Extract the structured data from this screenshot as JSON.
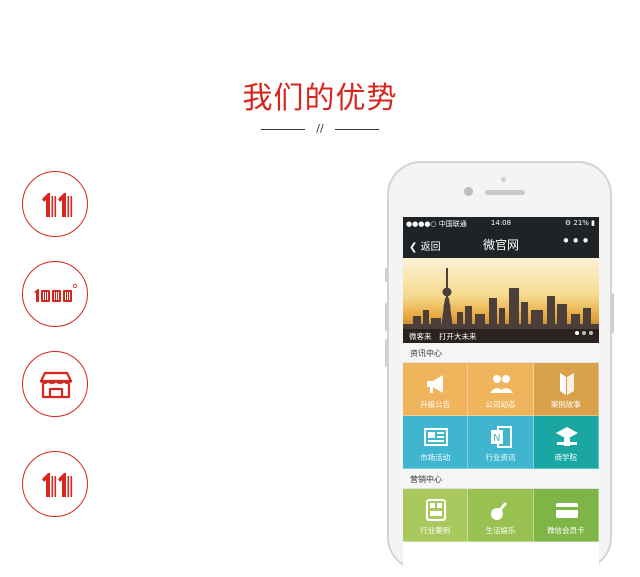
{
  "header": {
    "title": "我们的优势",
    "divider_mark": "//"
  },
  "features": [
    {
      "icon": "eleven-icon"
    },
    {
      "icon": "thousand-icon"
    },
    {
      "icon": "storefront-icon"
    },
    {
      "icon": "eleven-icon"
    }
  ],
  "phone": {
    "status": {
      "carrier": "●●●●○ 中国联通",
      "time": "14:08",
      "battery": "21%"
    },
    "nav": {
      "back": "返回",
      "title": "微官网",
      "more": "•••"
    },
    "banner": {
      "caption": "微客来　打开大未来",
      "dots": 3,
      "active_dot": 1
    },
    "sections": [
      {
        "title": "资讯中心",
        "tiles": [
          {
            "label": "升级公告",
            "icon": "megaphone-icon",
            "color": "#f0b45c"
          },
          {
            "label": "公司动态",
            "icon": "users-icon",
            "color": "#f0b45c"
          },
          {
            "label": "案例故事",
            "icon": "book-icon",
            "color": "#d9a24a"
          },
          {
            "label": "市场活动",
            "icon": "newspaper-icon",
            "color": "#3fb5cf"
          },
          {
            "label": "行业资讯",
            "icon": "onenote-icon",
            "color": "#3fb5cf"
          },
          {
            "label": "商学院",
            "icon": "graduation-icon",
            "color": "#1aa7a3"
          }
        ]
      },
      {
        "title": "营销中心",
        "tiles": [
          {
            "label": "行业案例",
            "icon": "case-icon",
            "color": "#a9c95e"
          },
          {
            "label": "生活娱乐",
            "icon": "guitar-icon",
            "color": "#98c151"
          },
          {
            "label": "微信会员卡",
            "icon": "card-icon",
            "color": "#7fb546"
          }
        ]
      }
    ]
  },
  "colors": {
    "accent": "#d7261e",
    "nav_bg": "#1f2326"
  }
}
